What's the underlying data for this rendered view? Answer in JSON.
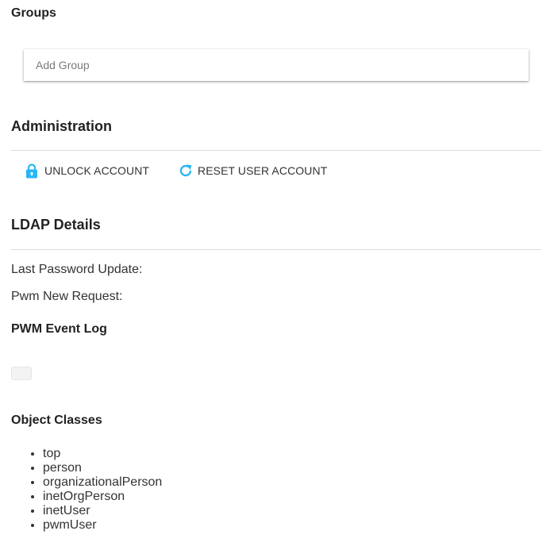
{
  "groups": {
    "heading": "Groups",
    "add_group_placeholder": "Add Group"
  },
  "administration": {
    "heading": "Administration",
    "unlock_label": "UNLOCK ACCOUNT",
    "reset_label": "RESET USER ACCOUNT",
    "unlock_icon": "lock-icon",
    "reset_icon": "refresh-icon",
    "icon_color": "#29b6f6"
  },
  "ldap": {
    "heading": "LDAP Details",
    "last_password_update_label": "Last Password Update:",
    "pwm_new_request_label": "Pwm New Request:"
  },
  "event_log": {
    "heading": "PWM Event Log"
  },
  "object_classes": {
    "heading": "Object Classes",
    "items": [
      "top",
      "person",
      "organizationalPerson",
      "inetOrgPerson",
      "inetUser",
      "pwmUser"
    ]
  }
}
